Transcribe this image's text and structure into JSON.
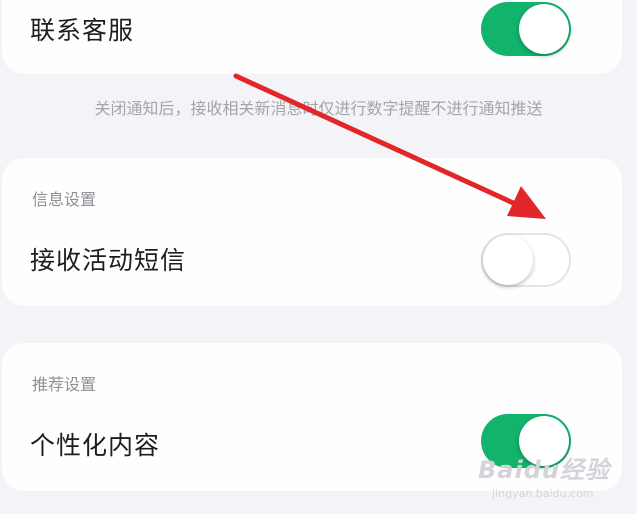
{
  "contact_service": {
    "label": "联系客服",
    "enabled": true
  },
  "notice": "关闭通知后，接收相关新消息时仅进行数字提醒不进行通知推送",
  "info_settings": {
    "title": "信息设置",
    "items": [
      {
        "label": "接收活动短信",
        "enabled": false
      }
    ]
  },
  "recommend_settings": {
    "title": "推荐设置",
    "items": [
      {
        "label": "个性化内容",
        "enabled": true
      }
    ]
  },
  "annotation": {
    "arrow_color": "#e3262a"
  },
  "colors": {
    "toggle_on": "#12b36b",
    "background": "#f3f3f8"
  },
  "watermark": {
    "logo": "Baidu经验",
    "url": "jingyan.baidu.com"
  }
}
